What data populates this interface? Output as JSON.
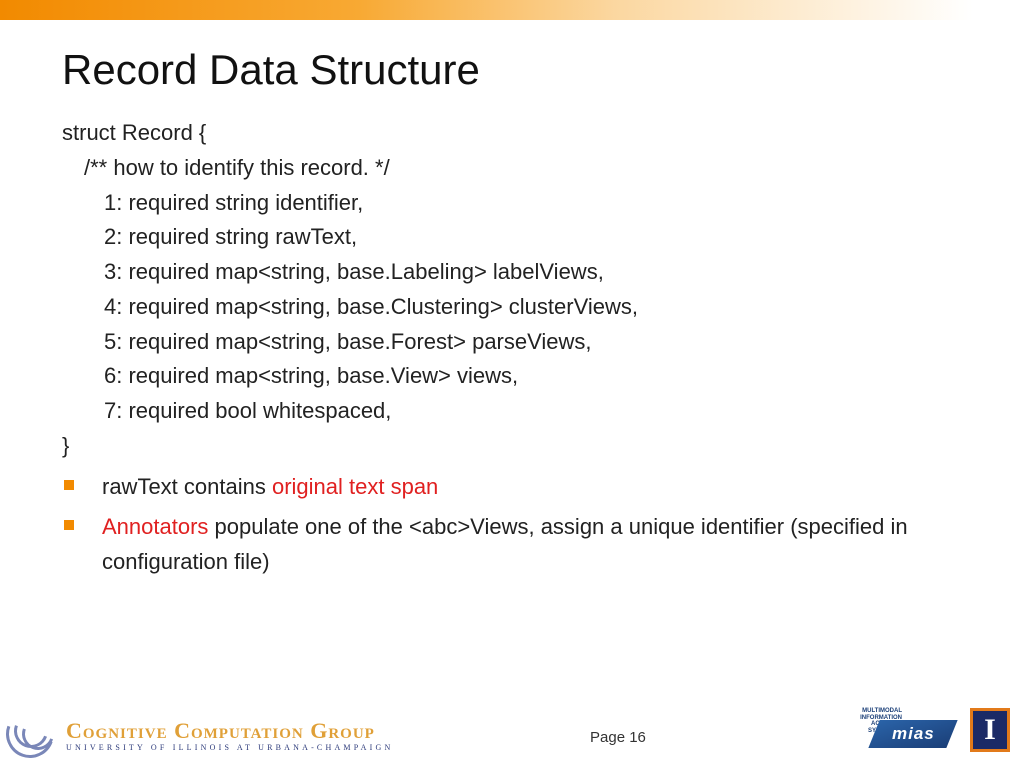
{
  "slide": {
    "title": "Record Data Structure",
    "page_label": "Page 16",
    "page_number": 16
  },
  "code": {
    "open": "struct Record {",
    "comment": "/** how to identify this record. */",
    "fields": [
      "1: required string identifier,",
      "2: required string rawText,",
      "3: required map<string, base.Labeling> labelViews,",
      "4: required map<string, base.Clustering> clusterViews,",
      "5: required map<string, base.Forest> parseViews,",
      "6: required map<string, base.View> views,",
      "7: required bool whitespaced,"
    ],
    "close": "}"
  },
  "bullets": {
    "b1_pre": "rawText contains ",
    "b1_red": "original text span",
    "b2_red": "Annotators",
    "b2_rest": " populate one of the <abc>Views, assign a unique identifier (specified in configuration file)"
  },
  "logos": {
    "ccg_name": "Cognitive Computation Group",
    "ccg_sub": "UNIVERSITY OF ILLINOIS AT URBANA-CHAMPAIGN",
    "mias_label": "mias",
    "mias_tag": "MULTIMODAL INFORMATION ACCESS & SYNTHESIS",
    "illinois_letter": "I"
  },
  "colors": {
    "accent": "#f28a00",
    "emphasis": "#e02020"
  }
}
